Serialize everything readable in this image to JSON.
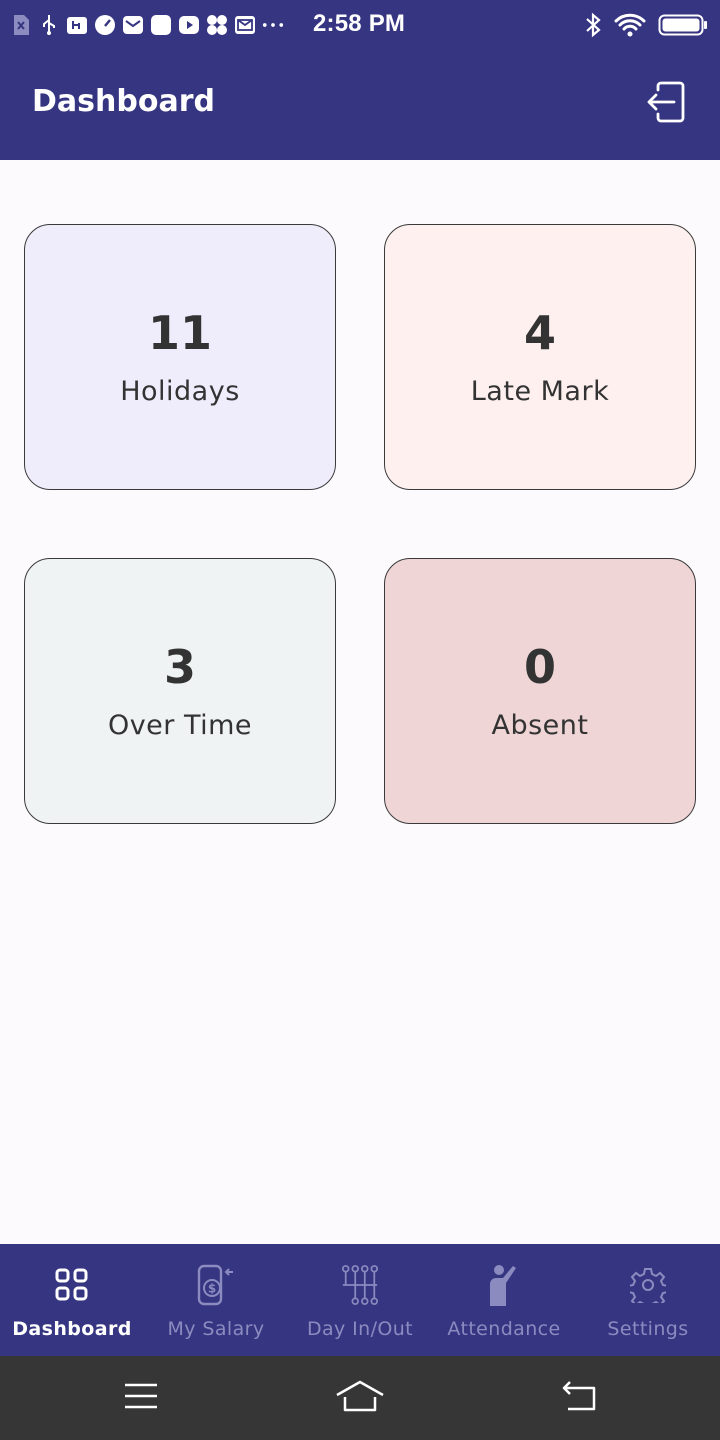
{
  "status_bar": {
    "time": "2:58 PM",
    "left_icons": [
      "sim-x-icon",
      "usb-icon",
      "usb-debug-icon",
      "speed-icon",
      "mail-icon",
      "app-icon",
      "youtube-icon",
      "fan-icon",
      "message-icon",
      "more-dots-icon"
    ],
    "right_icons": [
      "bluetooth-icon",
      "wifi-icon",
      "battery-icon"
    ]
  },
  "app_bar": {
    "title": "Dashboard",
    "action_icon": "logout-icon"
  },
  "cards": [
    {
      "value": "11",
      "label": "Holidays",
      "bg": "#efedfc"
    },
    {
      "value": "4",
      "label": "Late Mark",
      "bg": "#fdf0ef"
    },
    {
      "value": "3",
      "label": "Over Time",
      "bg": "#eff3f4"
    },
    {
      "value": "0",
      "label": "Absent",
      "bg": "#efd5d6"
    }
  ],
  "bottom_nav": {
    "items": [
      {
        "label": "Dashboard",
        "icon": "dashboard-grid-icon",
        "active": true
      },
      {
        "label": "My Salary",
        "icon": "salary-phone-icon",
        "active": false
      },
      {
        "label": "Day In/Out",
        "icon": "day-in-out-icon",
        "active": false
      },
      {
        "label": "Attendance",
        "icon": "attendance-person-icon",
        "active": false
      },
      {
        "label": "Settings",
        "icon": "gear-icon",
        "active": false
      }
    ]
  },
  "colors": {
    "primary": "#363582",
    "nav_inactive": "#8b8bc0",
    "system_nav": "#363636",
    "background": "#fdfafe"
  }
}
